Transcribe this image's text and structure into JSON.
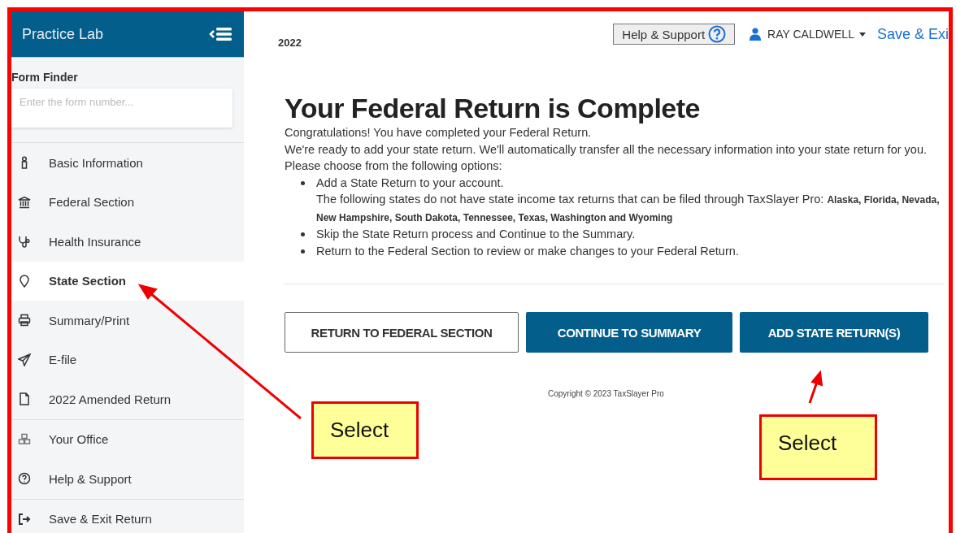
{
  "sidebar": {
    "title": "Practice Lab",
    "form_finder": {
      "label": "Form Finder",
      "placeholder": "Enter the form number..."
    },
    "groups": [
      [
        {
          "label": "Basic Information",
          "selected": false
        },
        {
          "label": "Federal Section",
          "selected": false
        },
        {
          "label": "Health Insurance",
          "selected": false
        },
        {
          "label": "State Section",
          "selected": true
        },
        {
          "label": "Summary/Print",
          "selected": false
        },
        {
          "label": "E-file",
          "selected": false
        },
        {
          "label": "2022 Amended Return",
          "selected": false
        }
      ],
      [
        {
          "label": "Your Office",
          "selected": false
        },
        {
          "label": "Help & Support",
          "selected": false
        }
      ],
      [
        {
          "label": "Save & Exit Return",
          "selected": false
        }
      ]
    ]
  },
  "header": {
    "year": "2022",
    "help_button": "Help & Support",
    "user": "RAY CALDWELL",
    "save_link": "Save & Exi"
  },
  "main": {
    "heading": "Your Federal Return is Complete",
    "paragraphs": [
      "Congratulations! You have completed your Federal Return.",
      "We're ready to add your state return. We'll automatically transfer all the necessary information into your state return for you.",
      "Please choose from the following options:"
    ],
    "options": [
      {
        "text": "Add a State Return to your account.",
        "note": "The following states do not have state income tax returns that can be filed through TaxSlayer Pro: **Alaska, Florida, Nevada, New Hampshire, South Dakota, Tennessee, Texas, Washington and Wyoming**"
      },
      {
        "text": "Skip the State Return process and Continue to the Summary."
      },
      {
        "text": "Return to the Federal Section to review or make changes to your Federal Return."
      }
    ],
    "buttons": [
      {
        "label": "RETURN TO FEDERAL SECTION",
        "kind": "outline"
      },
      {
        "label": "CONTINUE TO SUMMARY",
        "kind": "primary"
      },
      {
        "label": "ADD STATE RETURN(S)",
        "kind": "primary"
      }
    ],
    "copyright": "Copyright © 2023 TaxSlayer Pro"
  },
  "annotations": [
    {
      "text": "Select"
    },
    {
      "text": "Select"
    }
  ]
}
